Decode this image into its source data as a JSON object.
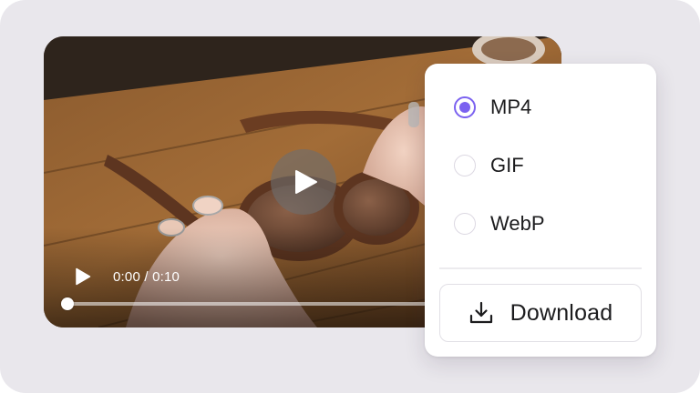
{
  "player": {
    "time_display": "0:00 / 0:10",
    "progress_percent": 0,
    "icons": {
      "center_play": "play-icon",
      "control_play": "play-icon"
    }
  },
  "format_picker": {
    "options": [
      {
        "label": "MP4",
        "selected": true
      },
      {
        "label": "GIF",
        "selected": false
      },
      {
        "label": "WebP",
        "selected": false
      }
    ],
    "download_label": "Download",
    "download_icon": "download-icon"
  },
  "colors": {
    "accent": "#7b62f0",
    "background": "#e9e7ec",
    "card": "#ffffff",
    "text": "#1c1c1e"
  }
}
